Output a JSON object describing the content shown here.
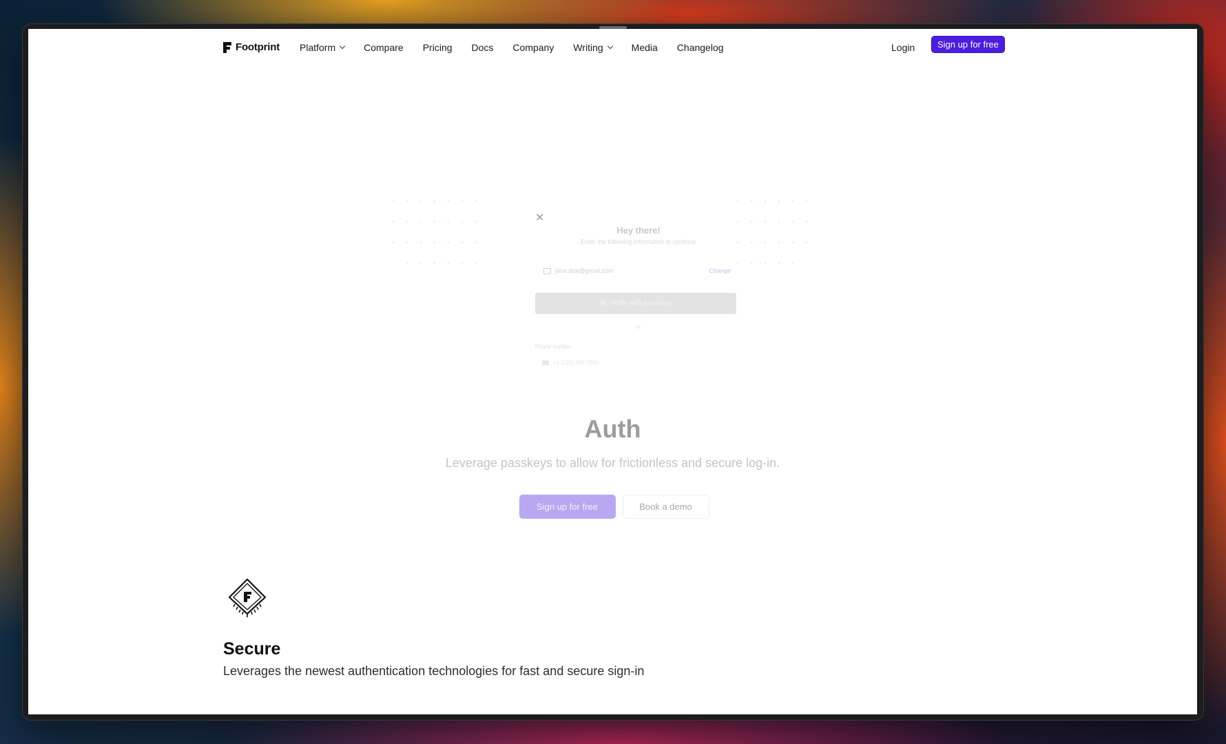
{
  "brand": {
    "name": "Footprint"
  },
  "nav": {
    "items": [
      {
        "label": "Platform",
        "has_dropdown": true
      },
      {
        "label": "Compare",
        "has_dropdown": false
      },
      {
        "label": "Pricing",
        "has_dropdown": false
      },
      {
        "label": "Docs",
        "has_dropdown": false
      },
      {
        "label": "Company",
        "has_dropdown": false
      },
      {
        "label": "Writing",
        "has_dropdown": true
      },
      {
        "label": "Media",
        "has_dropdown": false
      },
      {
        "label": "Changelog",
        "has_dropdown": false
      }
    ],
    "login_label": "Login",
    "signup_label": "Sign up for free"
  },
  "modal": {
    "title": "Hey there!",
    "subtitle": "Enter the following information to continue",
    "email_value": "jane.doe@gmail.com",
    "change_label": "Change",
    "passkey_button": "Verify with passkeys",
    "or_label": "or",
    "phone_label": "Phone number",
    "phone_placeholder": "+1 (123) 456-7890"
  },
  "hero": {
    "title": "Auth",
    "description": "Leverage passkeys to allow for frictionless and secure log-in.",
    "signup_label": "Sign up for free",
    "demo_label": "Book a demo"
  },
  "feature": {
    "icon": "chip-icon",
    "title": "Secure",
    "description": "Leverages the newest authentication technologies for fast and secure sign-in"
  },
  "colors": {
    "accent": "#4a1de0",
    "accent_faded": "#b9a7f2"
  }
}
